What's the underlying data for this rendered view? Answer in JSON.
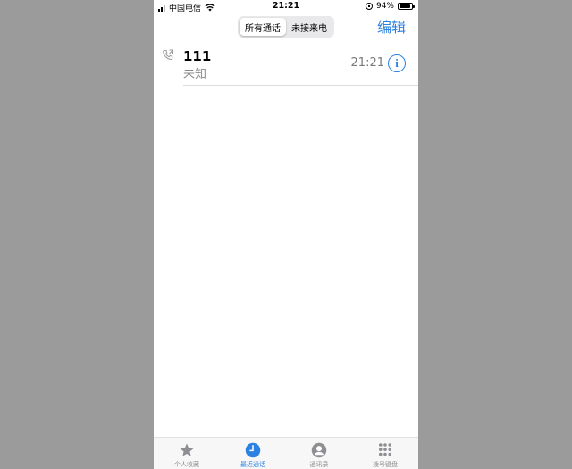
{
  "status_bar": {
    "carrier": "中国电信",
    "time": "21:21",
    "battery": "94%",
    "battery_level": 0.94
  },
  "header": {
    "segments": [
      {
        "label": "所有通话",
        "selected": true
      },
      {
        "label": "未接来电",
        "selected": false
      }
    ],
    "edit_label": "编辑"
  },
  "calls": [
    {
      "name": "111",
      "subtitle": "未知",
      "time": "21:21",
      "icon": "phone-outgoing-icon"
    }
  ],
  "tabbar": {
    "items": [
      {
        "label": "个人收藏",
        "icon": "star-icon",
        "active": false
      },
      {
        "label": "最近通话",
        "icon": "clock-icon",
        "active": true
      },
      {
        "label": "通讯录",
        "icon": "person-circle-icon",
        "active": false
      },
      {
        "label": "拨号键盘",
        "icon": "keypad-icon",
        "active": false
      }
    ]
  },
  "colors": {
    "accent": "#2b82e2",
    "background": "#9b9b9b",
    "tab_inactive": "#8e8e93"
  }
}
